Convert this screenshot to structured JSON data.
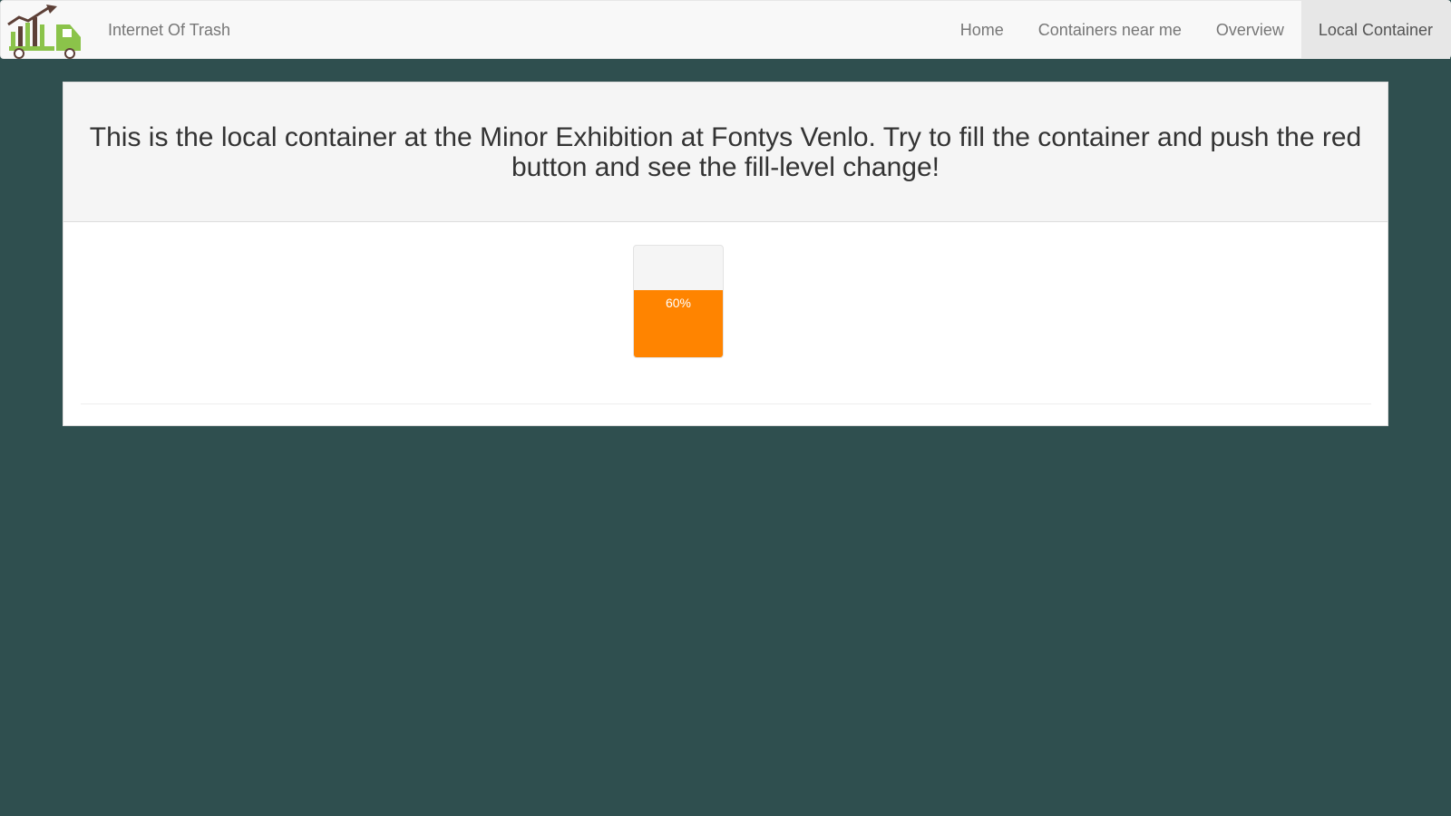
{
  "navbar": {
    "brand": "Internet Of Trash",
    "items": [
      {
        "label": "Home",
        "active": false
      },
      {
        "label": "Containers near me",
        "active": false
      },
      {
        "label": "Overview",
        "active": false
      },
      {
        "label": "Local Container",
        "active": true
      }
    ],
    "logo_icon": "trash-truck-chart-icon"
  },
  "panel": {
    "heading": "This is the local container at the Minor Exhibition at Fontys Venlo. Try to fill the container and push the red button and see the fill-level change!"
  },
  "container": {
    "fill_level_percent": 60,
    "fill_label": "60%"
  },
  "colors": {
    "page_background": "#2f4f4f",
    "fill": "#ff8400",
    "logo_green": "#8bc34a",
    "logo_dark": "#5d4037"
  }
}
